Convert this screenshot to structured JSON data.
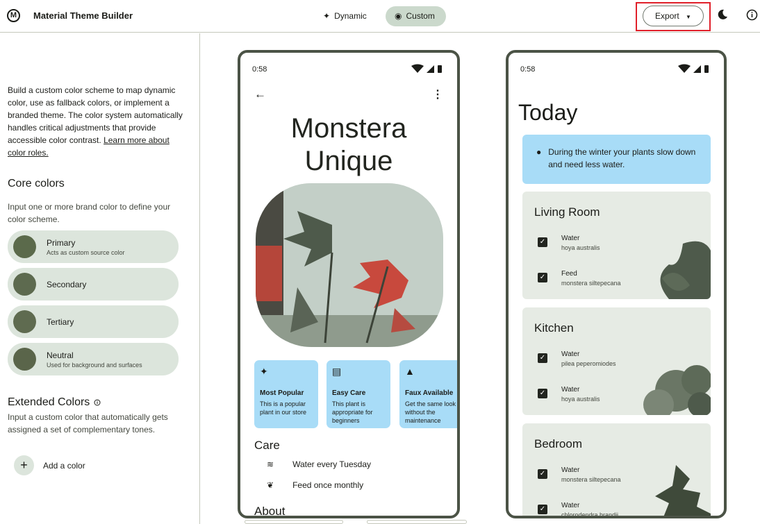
{
  "header": {
    "app_title": "Material Theme Builder",
    "logo_text": "M",
    "modes": [
      {
        "label": "Dynamic",
        "icon": "sparkle-icon"
      },
      {
        "label": "Custom",
        "icon": "palette-icon"
      }
    ],
    "export_label": "Export",
    "export_icon": "caret-down-icon",
    "icons": [
      "dark-mode-icon",
      "info-icon"
    ]
  },
  "sidebar": {
    "intro": "Build a custom color scheme to map dynamic color, use as fallback colors, or implement a branded theme. The color system automatically handles critical adjustments that provide accessible color contrast.",
    "intro_link": "Learn more about color roles.",
    "core_heading": "Core colors",
    "core_desc": "Input one or more brand color to define your color scheme.",
    "core_colors": [
      {
        "name": "Primary",
        "sub": "Acts as custom source color",
        "color": "#5b6a4b"
      },
      {
        "name": "Secondary",
        "sub": "",
        "color": "#5d6a4f"
      },
      {
        "name": "Tertiary",
        "sub": "",
        "color": "#5f6b50"
      },
      {
        "name": "Neutral",
        "sub": "Used for background and surfaces",
        "color": "#5a654a"
      }
    ],
    "ext_heading": "Extended Colors",
    "ext_desc": "Input a custom color that automatically gets assigned a set of complementary tones.",
    "add_label": "Add a color"
  },
  "phone1": {
    "time": "0:58",
    "status": "▼◢▮",
    "title_line1": "Monstera",
    "title_line2": "Unique",
    "features": [
      {
        "icon": "✦",
        "title": "Most Popular",
        "desc": "This is a popular plant in our store"
      },
      {
        "icon": "▤",
        "title": "Easy Care",
        "desc": "This plant is appropriate for beginners"
      },
      {
        "icon": "▲",
        "title": "Faux Available",
        "desc": "Get the same look without the maintenance"
      }
    ],
    "care_heading": "Care",
    "care": [
      {
        "icon": "≋",
        "text": "Water every Tuesday"
      },
      {
        "icon": "❦",
        "text": "Feed once monthly"
      }
    ],
    "about_heading": "About"
  },
  "phone2": {
    "time": "0:58",
    "status": "▼◢▮",
    "heading": "Today",
    "tip": "During the winter your plants slow down and need less water.",
    "rooms": [
      {
        "name": "Living Room",
        "tasks": [
          {
            "name": "Water",
            "sub": "hoya australis"
          },
          {
            "name": "Feed",
            "sub": "monstera siltepecana"
          }
        ]
      },
      {
        "name": "Kitchen",
        "tasks": [
          {
            "name": "Water",
            "sub": "pilea peperomiodes"
          },
          {
            "name": "Water",
            "sub": "hoya australis"
          }
        ]
      },
      {
        "name": "Bedroom",
        "tasks": [
          {
            "name": "Water",
            "sub": "monstera siltepecana"
          },
          {
            "name": "Water",
            "sub": "chlorodendra brandii"
          }
        ]
      }
    ]
  }
}
